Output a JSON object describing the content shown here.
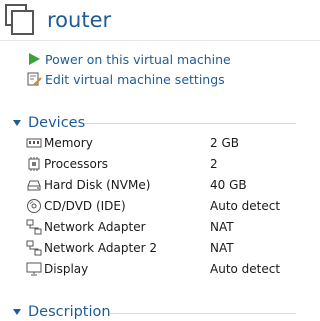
{
  "vm": {
    "name": "router"
  },
  "actions": [
    {
      "label": "Power on this virtual machine",
      "icon": "play-icon"
    },
    {
      "label": "Edit virtual machine settings",
      "icon": "edit-settings-icon"
    }
  ],
  "devices_section": {
    "title": "Devices",
    "items": [
      {
        "name": "Memory",
        "value": "2 GB",
        "icon": "memory-icon"
      },
      {
        "name": "Processors",
        "value": "2",
        "icon": "processor-icon"
      },
      {
        "name": "Hard Disk (NVMe)",
        "value": "40 GB",
        "icon": "hard-disk-icon"
      },
      {
        "name": "CD/DVD (IDE)",
        "value": "Auto detect",
        "icon": "cd-dvd-icon"
      },
      {
        "name": "Network Adapter",
        "value": "NAT",
        "icon": "network-adapter-icon"
      },
      {
        "name": "Network Adapter 2",
        "value": "NAT",
        "icon": "network-adapter-icon"
      },
      {
        "name": "Display",
        "value": "Auto detect",
        "icon": "display-icon"
      }
    ]
  },
  "description_section": {
    "title": "Description"
  },
  "colors": {
    "accent": "#1f5c96",
    "play": "#3aa23a"
  }
}
